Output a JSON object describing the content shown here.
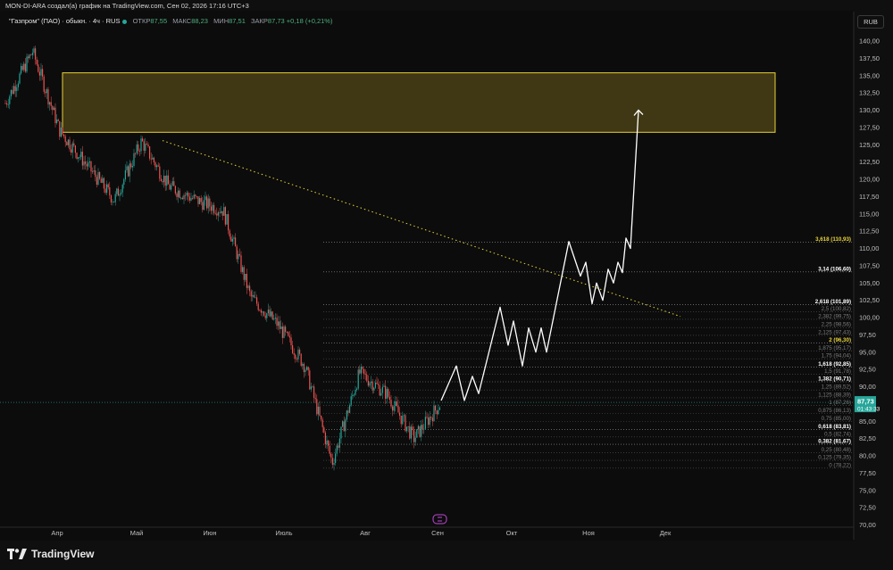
{
  "header": {
    "caption": "MON-DI-ARA создал(а) график на TradingView.com, Сен 02, 2026 17:16 UTC+3"
  },
  "legend": {
    "symbol": "\"Газпром\" (ПАО) · обыкн. · 4ч · RUS",
    "open_label": "ОТКР",
    "open_value": "87,55",
    "high_label": "МАКС",
    "high_value": "88,23",
    "low_label": "МИН",
    "low_value": "87,51",
    "close_label": "ЗАКР",
    "close_value": "87,73 +0,18 (+0,21%)"
  },
  "currency_button": "RUB",
  "price_tag": {
    "price": "87,73",
    "countdown": "01:43:33",
    "color": "#26a69a"
  },
  "logo_text": "TradingView",
  "colors": {
    "up": "#26a69a",
    "down": "#ef5350",
    "zone_fill": "#4a4016",
    "zone_border": "#e8d33a",
    "trendline": "#e8d33a",
    "projection": "#ffffff"
  },
  "chart_data": {
    "type": "candlestick",
    "title": "",
    "y_axis_ticks": [
      "140,00",
      "137,50",
      "135,00",
      "132,50",
      "130,00",
      "127,50",
      "125,00",
      "122,50",
      "120,00",
      "117,50",
      "115,00",
      "112,50",
      "110,00",
      "107,50",
      "105,00",
      "102,50",
      "100,00",
      "97,50",
      "95,00",
      "92,50",
      "90,00",
      "87,50",
      "85,00",
      "82,50",
      "80,00",
      "77,50",
      "75,00",
      "72,50",
      "70,00"
    ],
    "ylim": [
      69.5,
      141.5
    ],
    "x_axis_ticks": [
      "Апр",
      "Май",
      "Июн",
      "Июль",
      "Авг",
      "Сен",
      "Окт",
      "Ноя",
      "Дек"
    ],
    "candles_close_path": [
      {
        "x": "Мар, конец",
        "y": 131
      },
      {
        "x": "Апр, начало",
        "y": 138.5
      },
      {
        "x": "Апр, середина",
        "y": 127
      },
      {
        "x": "Апр, конец",
        "y": 122
      },
      {
        "x": "Май, начало",
        "y": 117
      },
      {
        "x": "Май, середина",
        "y": 125.5
      },
      {
        "x": "Май, конец",
        "y": 119
      },
      {
        "x": "Июн, начало",
        "y": 117
      },
      {
        "x": "Июн, середина",
        "y": 115.5
      },
      {
        "x": "Июн, конец",
        "y": 103
      },
      {
        "x": "Июль, начало",
        "y": 99
      },
      {
        "x": "Июль, середина",
        "y": 93
      },
      {
        "x": "Июль, конец",
        "y": 79
      },
      {
        "x": "Авг, начало",
        "y": 92
      },
      {
        "x": "Авг, середина",
        "y": 89
      },
      {
        "x": "Авг, конец",
        "y": 82.5
      },
      {
        "x": "Сен, начало",
        "y": 87.73
      }
    ],
    "last_price": 87.73,
    "resistance_zone": [
      126.8,
      135.4
    ],
    "trendline": {
      "from": {
        "x": "Май",
        "y": 125.6
      },
      "to": {
        "x": "Ноя",
        "y": 107
      }
    },
    "projection_path": [
      {
        "x": "Сен",
        "y": 88
      },
      {
        "x": "Сен",
        "y": 93
      },
      {
        "x": "Сен",
        "y": 88
      },
      {
        "x": "Сен",
        "y": 91.5
      },
      {
        "x": "Окт",
        "y": 89
      },
      {
        "x": "Окт",
        "y": 101.5
      },
      {
        "x": "Окт",
        "y": 96
      },
      {
        "x": "Окт",
        "y": 99.5
      },
      {
        "x": "Окт",
        "y": 93
      },
      {
        "x": "Окт",
        "y": 98.5
      },
      {
        "x": "Окт",
        "y": 95
      },
      {
        "x": "Окт",
        "y": 98.5
      },
      {
        "x": "Окт",
        "y": 95
      },
      {
        "x": "Ноя",
        "y": 111
      },
      {
        "x": "Ноя",
        "y": 106
      },
      {
        "x": "Ноя",
        "y": 108
      },
      {
        "x": "Ноя",
        "y": 102
      },
      {
        "x": "Ноя",
        "y": 105
      },
      {
        "x": "Ноя",
        "y": 102.5
      },
      {
        "x": "Ноя",
        "y": 107
      },
      {
        "x": "Ноя",
        "y": 105
      },
      {
        "x": "Ноя",
        "y": 108
      },
      {
        "x": "Ноя",
        "y": 106.5
      },
      {
        "x": "Ноя",
        "y": 111.5
      },
      {
        "x": "Ноя",
        "y": 110
      },
      {
        "x": "Дек",
        "y": 130
      }
    ],
    "fib_levels": [
      {
        "label": "3,618 (110,93)",
        "value": 110.93,
        "color": "#e8d33a",
        "bold": true
      },
      {
        "label": "3,14 (106,60)",
        "value": 106.6,
        "color": "#ffffff",
        "bold": true
      },
      {
        "label": "2,618 (101,89)",
        "value": 101.89,
        "color": "#ffffff",
        "bold": true
      },
      {
        "label": "2,5 (100,82)",
        "value": 100.82,
        "color": "#7d7d7d",
        "bold": false
      },
      {
        "label": "2,382 (99,75)",
        "value": 99.75,
        "color": "#7d7d7d",
        "bold": false
      },
      {
        "label": "2,25 (98,56)",
        "value": 98.56,
        "color": "#7d7d7d",
        "bold": false
      },
      {
        "label": "2,125 (97,43)",
        "value": 97.43,
        "color": "#7d7d7d",
        "bold": false
      },
      {
        "label": "2 (96,30)",
        "value": 96.3,
        "color": "#e8d33a",
        "bold": true
      },
      {
        "label": "1,875 (95,17)",
        "value": 95.17,
        "color": "#7d7d7d",
        "bold": false
      },
      {
        "label": "1,75 (94,04)",
        "value": 94.04,
        "color": "#7d7d7d",
        "bold": false
      },
      {
        "label": "1,618 (92,85)",
        "value": 92.85,
        "color": "#ffffff",
        "bold": true
      },
      {
        "label": "1,5 (91,78)",
        "value": 91.78,
        "color": "#7d7d7d",
        "bold": false
      },
      {
        "label": "1,382 (90,71)",
        "value": 90.71,
        "color": "#ffffff",
        "bold": true
      },
      {
        "label": "1,25 (89,52)",
        "value": 89.52,
        "color": "#7d7d7d",
        "bold": false
      },
      {
        "label": "1,125 (88,39)",
        "value": 88.39,
        "color": "#7d7d7d",
        "bold": false
      },
      {
        "label": "1 (87,26)",
        "value": 87.26,
        "color": "#7d7d7d",
        "bold": false
      },
      {
        "label": "0,875 (86,13)",
        "value": 86.13,
        "color": "#7d7d7d",
        "bold": false
      },
      {
        "label": "0,75 (85,00)",
        "value": 85.0,
        "color": "#7d7d7d",
        "bold": false
      },
      {
        "label": "0,618 (83,81)",
        "value": 83.81,
        "color": "#ffffff",
        "bold": true
      },
      {
        "label": "0,5 (82,74)",
        "value": 82.74,
        "color": "#7d7d7d",
        "bold": false
      },
      {
        "label": "0,382 (81,67)",
        "value": 81.67,
        "color": "#ffffff",
        "bold": true
      },
      {
        "label": "0,25 (80,48)",
        "value": 80.48,
        "color": "#7d7d7d",
        "bold": false
      },
      {
        "label": "0,125 (79,35)",
        "value": 79.35,
        "color": "#7d7d7d",
        "bold": false
      },
      {
        "label": "0 (78,22)",
        "value": 78.22,
        "color": "#7d7d7d",
        "bold": false
      }
    ]
  }
}
